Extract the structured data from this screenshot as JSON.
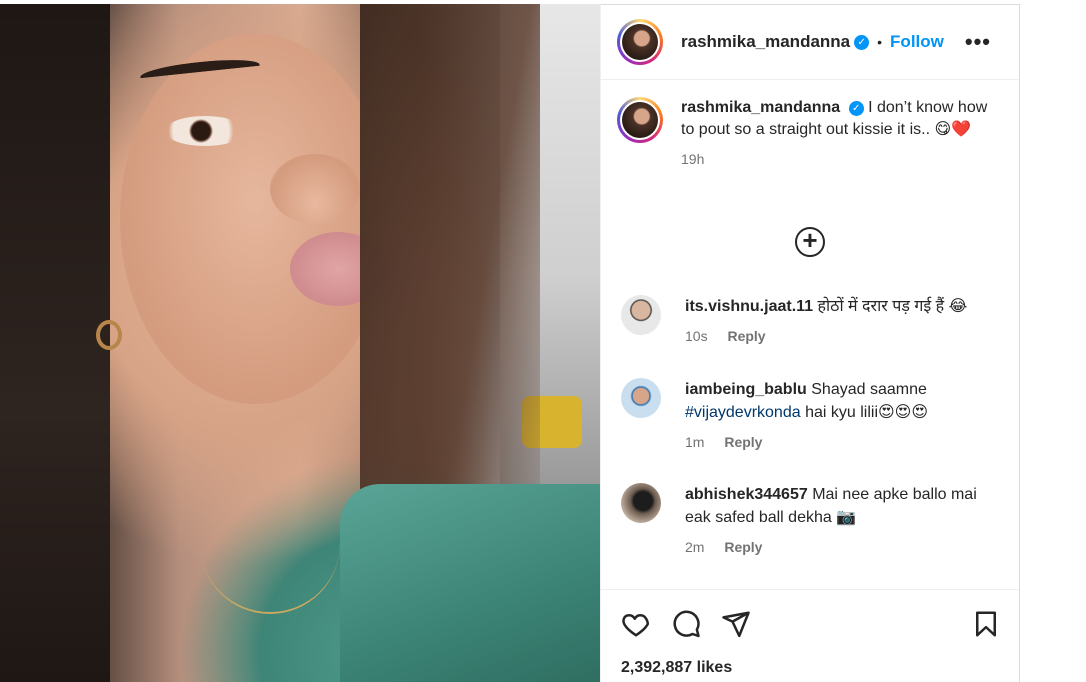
{
  "post": {
    "username": "rashmika_mandanna",
    "follow_label": "Follow",
    "dot_separator": "•",
    "more_label": "•••",
    "caption": "I don’t know how to pout so a straight out kissie it is.. 😋❤️",
    "caption_time": "19h",
    "load_more_label": "+",
    "likes": "2,392,887 likes"
  },
  "comments": [
    {
      "username": "its.vishnu.jaat.11",
      "text": "होठों में दरार पड़ गई हैं 😂",
      "time": "10s",
      "reply_label": "Reply"
    },
    {
      "username": "iambeing_bablu",
      "text_before": "Shayad saamne",
      "hashtag": "#vijaydevrkonda",
      "text_after": "hai kyu lilii😍😍😍",
      "time": "1m",
      "reply_label": "Reply"
    },
    {
      "username": "abhishek344657",
      "text": "Mai nee apke ballo mai eak safed ball dekha 📷",
      "time": "2m",
      "reply_label": "Reply"
    }
  ],
  "colors": {
    "accent": "#0095f6",
    "hashtag": "#00376b",
    "muted": "#737373"
  },
  "icons": [
    "verified-badge-icon",
    "more-options-icon",
    "load-more-comments-icon",
    "heart-icon",
    "comment-icon",
    "share-icon",
    "bookmark-icon"
  ]
}
